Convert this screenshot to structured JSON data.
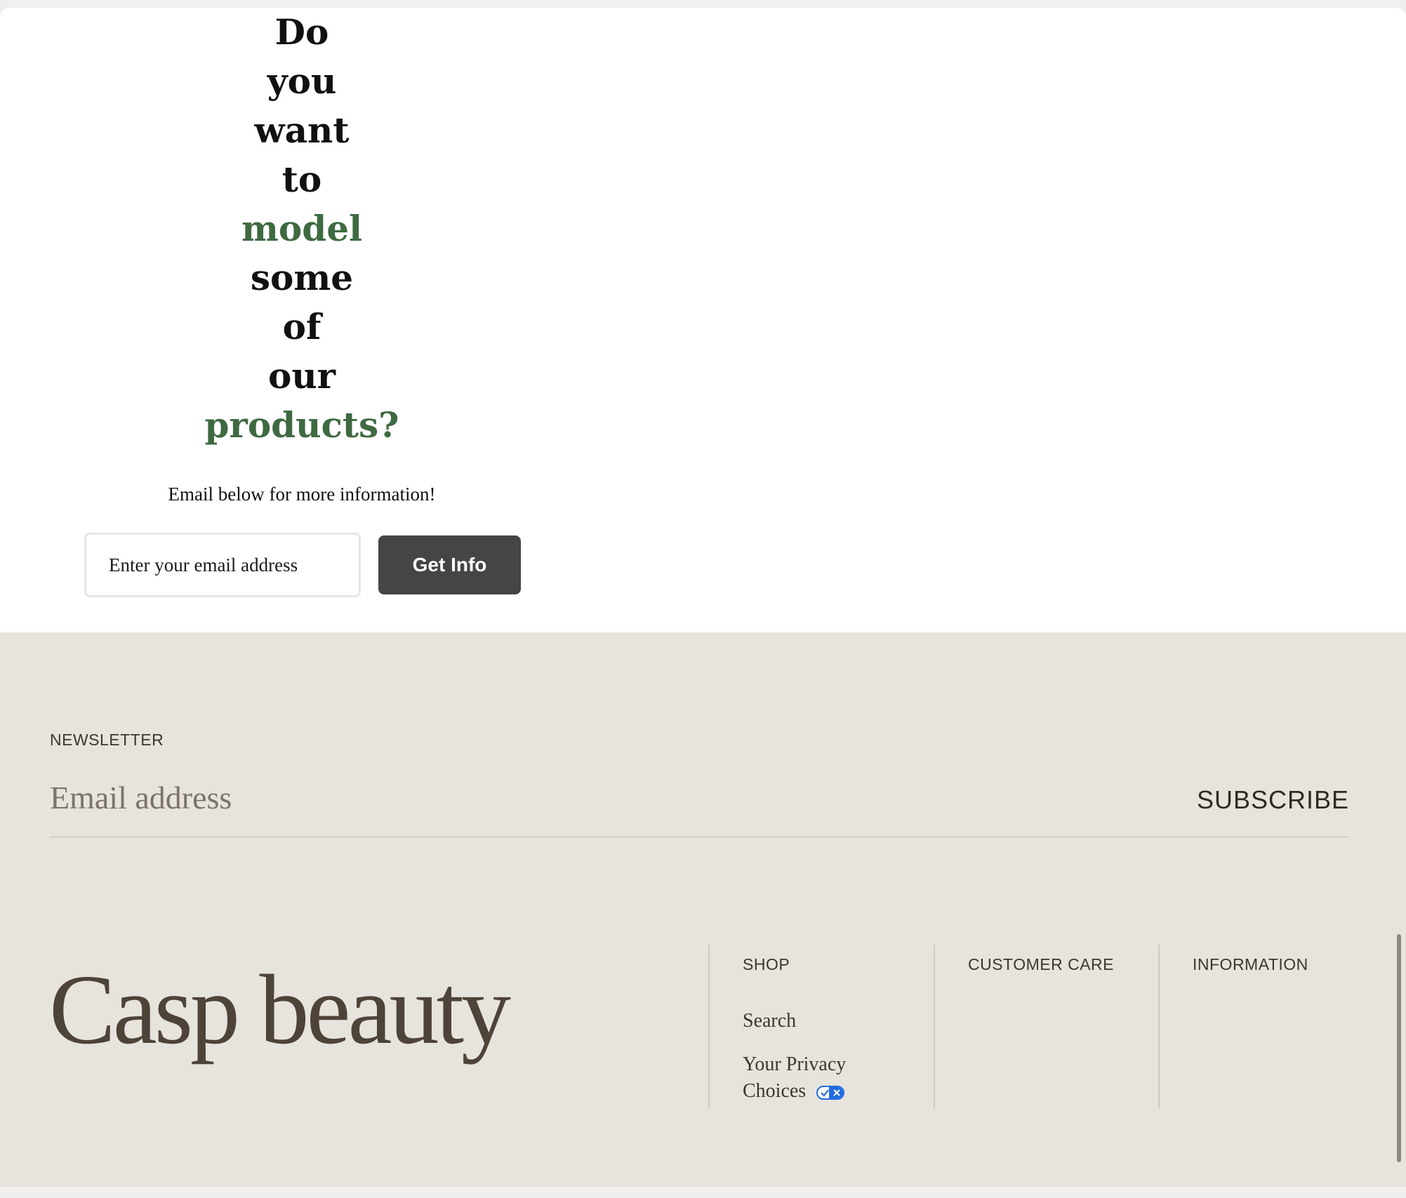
{
  "promo": {
    "headline_words": [
      "Do",
      "you",
      "want",
      "to",
      "model",
      "some",
      "of",
      "our",
      "products?"
    ],
    "accent_words": [
      "model",
      "products?"
    ],
    "accent_color": "#3f6a41",
    "subtext": "Email below for more information!",
    "email_placeholder": "Enter your email address",
    "button_label": "Get Info"
  },
  "footer": {
    "newsletter_label": "NEWSLETTER",
    "newsletter_placeholder": "Email address",
    "subscribe_label": "SUBSCRIBE",
    "logo": "Casp beauty",
    "columns": {
      "shop": {
        "heading": "SHOP",
        "links": [
          "Search",
          "Your Privacy Choices"
        ]
      },
      "customer_care": {
        "heading": "CUSTOMER CARE"
      },
      "information": {
        "heading": "INFORMATION"
      }
    }
  },
  "colors": {
    "footer_bg": "#e7e3dd",
    "button_bg": "#454545",
    "privacy_badge": "#1f6be0"
  }
}
